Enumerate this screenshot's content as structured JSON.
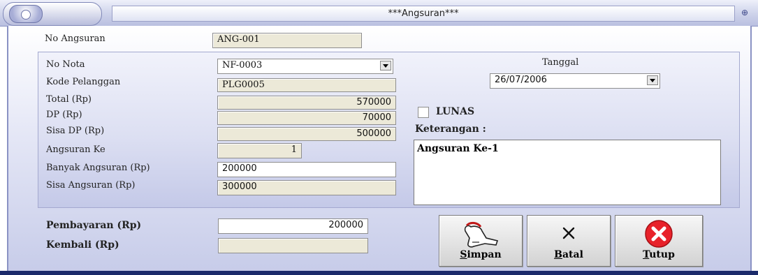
{
  "window": {
    "title": "***Angsuran***"
  },
  "form": {
    "no_angsuran": {
      "label": "No Angsuran",
      "value": "ANG-001"
    },
    "no_nota": {
      "label": "No Nota",
      "value": "NF-0003"
    },
    "kode_pelanggan": {
      "label": "Kode Pelanggan",
      "value": "PLG0005"
    },
    "total": {
      "label": "Total (Rp)",
      "value": "570000"
    },
    "dp": {
      "label": "DP (Rp)",
      "value": "70000"
    },
    "sisa_dp": {
      "label": "Sisa DP (Rp)",
      "value": "500000"
    },
    "angsuran_ke": {
      "label": "Angsuran Ke",
      "value": "1"
    },
    "banyak_angsuran": {
      "label": "Banyak Angsuran (Rp)",
      "value": "200000"
    },
    "sisa_angsuran": {
      "label": "Sisa Angsuran (Rp)",
      "value": "300000"
    },
    "tanggal": {
      "label": "Tanggal",
      "value": "26/07/2006"
    },
    "lunas": {
      "label": "LUNAS",
      "checked": false
    },
    "keterangan": {
      "label": "Keterangan :",
      "value": "Angsuran Ke-1"
    },
    "pembayaran": {
      "label": "Pembayaran (Rp)",
      "value": "200000"
    },
    "kembali": {
      "label": "Kembali (Rp)",
      "value": ""
    }
  },
  "buttons": {
    "simpan": "Simpan",
    "batal": "Batal",
    "tutup": "Tutup"
  },
  "icons": {
    "close_color": "#e8222a",
    "save": "hand-pointer-icon",
    "cancel": "x-cancel-icon",
    "exit": "red-x-circle-icon"
  }
}
